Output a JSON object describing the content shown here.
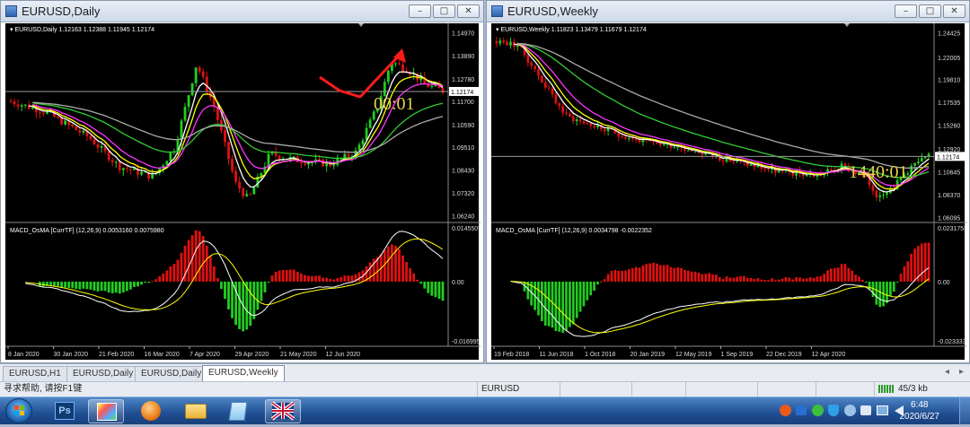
{
  "windows": [
    {
      "title": "EURUSD,Daily",
      "info": "EURUSD,Daily  1.12163 1.12388 1.11945 1.12174",
      "price_ticks": [
        "1.14970",
        "1.13890",
        "1.12780",
        "1.11700",
        "1.10590",
        "1.09510",
        "1.08430",
        "1.07320",
        "1.06240"
      ],
      "current_price": "1.12174",
      "timer": "00:01",
      "macd_label": "MACD_OsMA [CurrTF] (12,26,9) 0.0053160 0.0075980",
      "macd_ticks": [
        "0.0145509",
        "0.00",
        "-0.016995"
      ],
      "date_ticks": [
        "8 Jan 2020",
        "30 Jan 2020",
        "21 Feb 2020",
        "16 Mar 2020",
        "7 Apr 2020",
        "29 Apr 2020",
        "21 May 2020",
        "12 Jun 2020"
      ]
    },
    {
      "title": "EURUSD,Weekly",
      "info": "EURUSD,Weekly  1.11823 1.13479 1.11679 1.12174",
      "price_ticks": [
        "1.24425",
        "1.22005",
        "1.19810",
        "1.17535",
        "1.15260",
        "1.12920",
        "1.10645",
        "1.08370",
        "1.06095"
      ],
      "current_price": "1.12174",
      "timer": "1440:01",
      "macd_label": "MACD_OsMA [CurrTF] (12,26,9) 0.0034798 -0.0022352",
      "macd_ticks": [
        "0.0231755",
        "0.00",
        "-0.0233338"
      ],
      "date_ticks": [
        "19 Feb 2018",
        "11 Jun 2018",
        "1 Oct 2018",
        "20 Jan 2019",
        "12 May 2019",
        "1 Sep 2019",
        "22 Dec 2019",
        "12 Apr 2020"
      ]
    }
  ],
  "window_buttons": [
    "–",
    "□",
    "✕"
  ],
  "tabs": [
    "EURUSD,H1",
    "EURUSD,Daily",
    "EURUSD,Daily",
    "EURUSD,Weekly"
  ],
  "status": {
    "help": "寻求帮助, 请按F1键",
    "symbol": "EURUSD",
    "traffic": "45/3 kb"
  },
  "clock": {
    "time": "6:48",
    "date": "2020/6/27"
  },
  "taskbar_apps": [
    "start-orb",
    "photoshop",
    "paint",
    "app-orange",
    "folder",
    "notepad",
    "mt4-flag"
  ],
  "colors": {
    "bull": "#22cc22",
    "bear": "#e01010",
    "timer": "#e8d44a",
    "arrow": "#ff1a1a"
  }
}
